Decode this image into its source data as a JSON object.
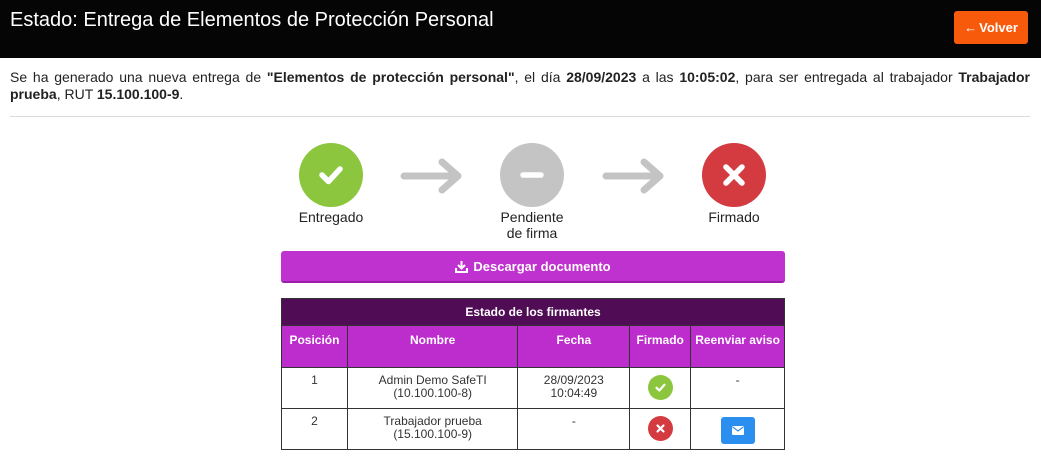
{
  "header": {
    "title": "Estado: Entrega de Elementos de Protección Personal",
    "back_label": "Volver",
    "back_color": "#f85a0b"
  },
  "intro": {
    "p1": "Se ha generado una nueva entrega de ",
    "item": "\"Elementos de protección personal\"",
    "p2": ", el día ",
    "date": "28/09/2023",
    "p3": " a las ",
    "time": "10:05:02",
    "p4": ", para ser entregada al trabajador ",
    "worker": "Trabajador prueba",
    "p5": ", RUT ",
    "rut": "15.100.100-9",
    "p6": "."
  },
  "steps": [
    {
      "label": "Entregado",
      "icon": "check-icon",
      "color": "#8cc63f"
    },
    {
      "label": "Pendiente de firma",
      "icon": "minus-icon",
      "color": "#c4c4c4"
    },
    {
      "label": "Firmado",
      "icon": "close-icon",
      "color": "#d33b40"
    }
  ],
  "download": {
    "label": "Descargar documento",
    "color": "#c032cf"
  },
  "signers": {
    "caption": "Estado de los firmantes",
    "columns": [
      "Posición",
      "Nombre",
      "Fecha",
      "Firmado",
      "Reenviar aviso"
    ],
    "rows": [
      {
        "position": "1",
        "name": "Admin Demo SafeTI",
        "id": "(10.100.100-8)",
        "date": "28/09/2023",
        "time": "10:04:49",
        "signed": "check-icon",
        "resend": "-"
      },
      {
        "position": "2",
        "name": "Trabajador prueba",
        "id": "(15.100.100-9)",
        "date": "-",
        "time": "",
        "signed": "close-icon",
        "resend": "envelope-icon"
      }
    ]
  }
}
